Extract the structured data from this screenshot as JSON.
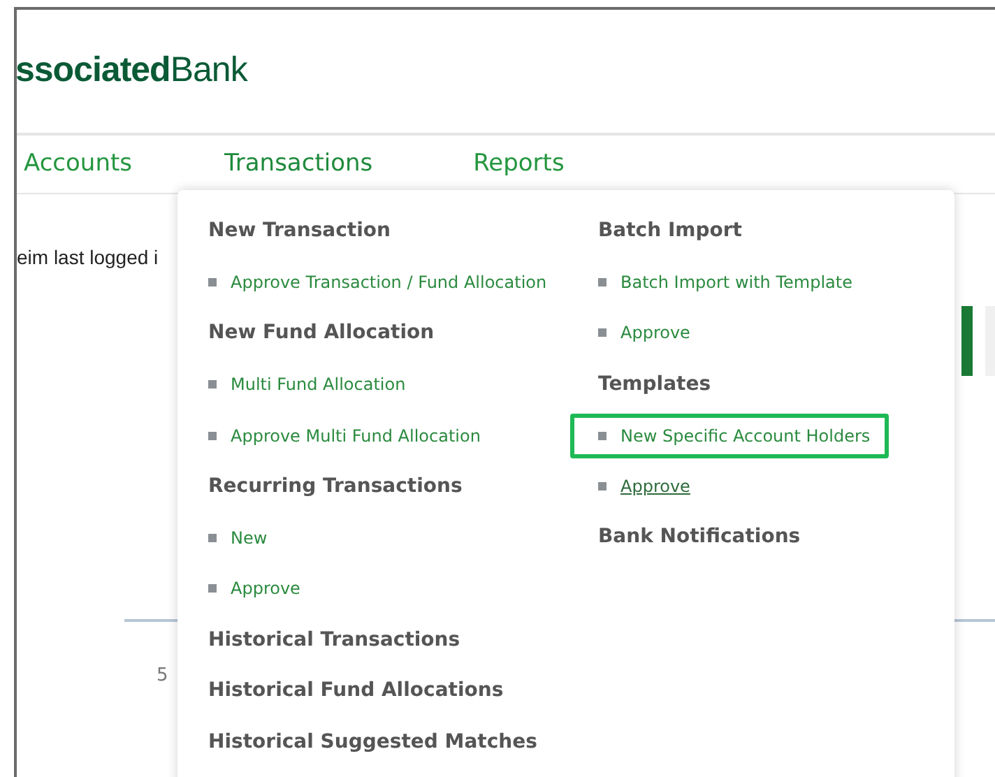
{
  "logo": {
    "bold": "ssociated",
    "regular": "Bank"
  },
  "nav": [
    {
      "label": "Accounts",
      "open": false
    },
    {
      "label": "Transactions",
      "open": true
    },
    {
      "label": "Reports",
      "open": false
    }
  ],
  "background": {
    "login_text": "eim last logged i",
    "chart_label": "5"
  },
  "menu": {
    "columns": [
      [
        {
          "kind": "heading",
          "label": "New Transaction"
        },
        {
          "kind": "link",
          "label": "Approve Transaction / Fund Allocation",
          "underlined": false,
          "highlighted": false
        },
        {
          "kind": "heading",
          "label": "New Fund Allocation"
        },
        {
          "kind": "link",
          "label": "Multi Fund Allocation",
          "underlined": false,
          "highlighted": false
        },
        {
          "kind": "link",
          "label": "Approve Multi Fund Allocation",
          "underlined": false,
          "highlighted": false
        },
        {
          "kind": "heading",
          "label": "Recurring Transactions"
        },
        {
          "kind": "link",
          "label": "New",
          "underlined": false,
          "highlighted": false
        },
        {
          "kind": "link",
          "label": "Approve",
          "underlined": false,
          "highlighted": false
        },
        {
          "kind": "heading",
          "label": "Historical Transactions"
        },
        {
          "kind": "heading",
          "label": "Historical Fund Allocations"
        },
        {
          "kind": "heading",
          "label": "Historical Suggested Matches"
        }
      ],
      [
        {
          "kind": "heading",
          "label": "Batch Import"
        },
        {
          "kind": "link",
          "label": "Batch Import with Template",
          "underlined": false,
          "highlighted": false
        },
        {
          "kind": "link",
          "label": "Approve",
          "underlined": false,
          "highlighted": false
        },
        {
          "kind": "heading",
          "label": "Templates"
        },
        {
          "kind": "link",
          "label": "New Specific Account Holders",
          "underlined": false,
          "highlighted": true
        },
        {
          "kind": "link",
          "label": "Approve",
          "underlined": true,
          "highlighted": false
        },
        {
          "kind": "heading",
          "label": "Bank Notifications"
        }
      ]
    ]
  }
}
